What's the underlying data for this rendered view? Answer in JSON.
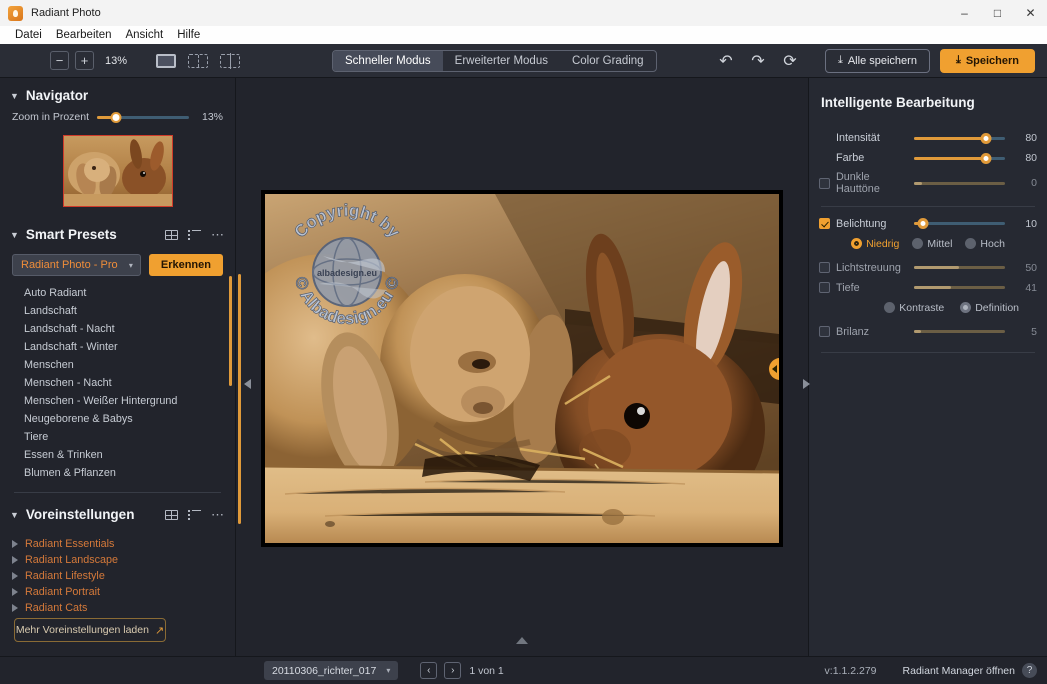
{
  "window": {
    "title": "Radiant Photo",
    "icon": "app-icon",
    "minimize": "–",
    "maximize": "□",
    "close": "✕"
  },
  "menubar": {
    "items": [
      {
        "label": "Datei"
      },
      {
        "label": "Bearbeiten"
      },
      {
        "label": "Ansicht"
      },
      {
        "label": "Hilfe"
      }
    ]
  },
  "toolbar": {
    "zoom_out": "−",
    "zoom_in": "+",
    "zoom_percent": "13%",
    "view_single": "single-view-icon",
    "view_split": "split-view-icon",
    "view_compare": "compare-view-icon",
    "modes": [
      {
        "label": "Schneller Modus",
        "active": true
      },
      {
        "label": "Erweiterter Modus",
        "active": false
      },
      {
        "label": "Color Grading",
        "active": false
      }
    ],
    "undo": "↶",
    "redo": "↷",
    "reset": "⟳",
    "save_all_label": "Alle speichern",
    "save_label": "Speichern",
    "download_glyph": "⤓"
  },
  "navigator": {
    "title": "Navigator",
    "caret": "▼",
    "zoom_label": "Zoom in Prozent",
    "zoom_value": "13%",
    "zoom_knob_pct": 21,
    "thumbnail": "navigator-thumbnail"
  },
  "smart_presets": {
    "title": "Smart Presets",
    "caret": "▼",
    "tool_grid": "grid-view-icon",
    "tool_list": "list-view-icon",
    "tool_more": "⋯",
    "selected_profile": "Radiant Photo - Pro",
    "select_caret": "▾",
    "detect_label": "Erkennen",
    "items": [
      {
        "label": "Auto Radiant"
      },
      {
        "label": "Landschaft"
      },
      {
        "label": "Landschaft - Nacht"
      },
      {
        "label": "Landschaft - Winter"
      },
      {
        "label": "Menschen"
      },
      {
        "label": "Menschen - Nacht"
      },
      {
        "label": "Menschen - Weißer Hintergrund"
      },
      {
        "label": "Neugeborene & Babys"
      },
      {
        "label": "Tiere"
      },
      {
        "label": "Essen & Trinken"
      },
      {
        "label": "Blumen & Pflanzen"
      }
    ]
  },
  "voreinstellungen": {
    "title": "Voreinstellungen",
    "caret": "▼",
    "tool_grid": "grid-view-icon",
    "tool_list": "list-view-icon",
    "tool_more": "⋯",
    "items": [
      {
        "label": "Radiant Essentials"
      },
      {
        "label": "Radiant Landscape"
      },
      {
        "label": "Radiant Lifestyle"
      },
      {
        "label": "Radiant Portrait"
      },
      {
        "label": "Radiant Cats"
      }
    ],
    "load_more_label": "Mehr Voreinstellungen laden",
    "load_more_icon": "↗"
  },
  "canvas": {
    "collapse_left": "collapse-left-arrow",
    "collapse_right": "collapse-right-arrow",
    "collapse_bottom": "collapse-bottom-arrow",
    "photo_alt": "Zwei Kaninchen im Stall",
    "watermark_top": "Copyright by",
    "watermark_bottom": "Albadesign.eu",
    "watermark_center": "albadesign.eu"
  },
  "right_panel": {
    "title": "Intelligente Bearbeitung",
    "controls": [
      {
        "name": "intensitaet",
        "label": "Intensität",
        "value": "80",
        "fill_pct": 80,
        "has_checkbox": false,
        "checked": false,
        "enabled": true
      },
      {
        "name": "farbe",
        "label": "Farbe",
        "value": "80",
        "fill_pct": 80,
        "has_checkbox": false,
        "checked": false,
        "enabled": true
      },
      {
        "name": "dunkle-hauttoene",
        "label": "Dunkle Hauttöne",
        "value": "0",
        "fill_pct": 8,
        "has_checkbox": true,
        "checked": false,
        "enabled": false
      }
    ],
    "controls2": [
      {
        "name": "belichtung",
        "label": "Belichtung",
        "value": "10",
        "fill_pct": 10,
        "has_checkbox": true,
        "checked": true,
        "enabled": true
      }
    ],
    "belichtung_radios": [
      {
        "label": "Niedrig",
        "selected": true
      },
      {
        "label": "Mittel",
        "selected": false
      },
      {
        "label": "Hoch",
        "selected": false
      }
    ],
    "controls3": [
      {
        "name": "lichtstreuung",
        "label": "Lichtstreuung",
        "value": "50",
        "fill_pct": 50,
        "has_checkbox": true,
        "checked": false,
        "enabled": false
      },
      {
        "name": "tiefe",
        "label": "Tiefe",
        "value": "41",
        "fill_pct": 41,
        "has_checkbox": true,
        "checked": false,
        "enabled": false
      }
    ],
    "tiefe_radios": [
      {
        "label": "Kontraste",
        "selected": false
      },
      {
        "label": "Definition",
        "selected": true
      }
    ],
    "controls4": [
      {
        "name": "brilanz",
        "label": "Brilanz",
        "value": "5",
        "fill_pct": 7,
        "has_checkbox": true,
        "checked": false,
        "enabled": false
      }
    ]
  },
  "statusbar": {
    "filename": "20110306_richter_017",
    "file_caret": "▾",
    "prev": "‹",
    "next": "›",
    "page_info": "1 von 1",
    "version": "v:1.1.2.279",
    "manager_label": "Radiant Manager öffnen",
    "help": "?"
  },
  "colors": {
    "accent": "#f0a030",
    "panel_bg": "#22242c",
    "right_panel_bg": "#262932",
    "slider_track": "#3f5d73",
    "preset_link": "#d4793a"
  }
}
